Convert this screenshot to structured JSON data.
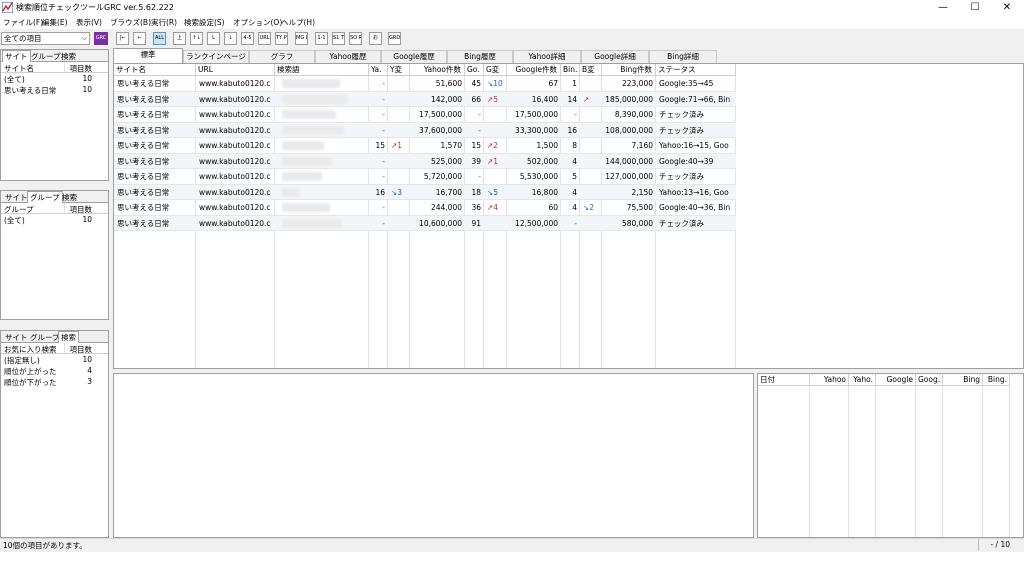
{
  "title": "検索順位チェックツールGRC  ver.5.62.222",
  "window_controls": {
    "minimize": "—",
    "maximize": "☐",
    "close": "✕"
  },
  "menu": [
    "ファイル(F)",
    "編集(E)",
    "表示(V)",
    "ブラウズ(B)",
    "実行(R)",
    "検索設定(S)",
    "オプション(O)",
    "ヘルプ(H)"
  ],
  "toolbar": {
    "filter_value": "全ての項目",
    "grc_label": "GRC",
    "buttons": [
      "|←",
      "←",
      "ALL",
      "上",
      "↑↓",
      "L",
      "↓",
      "4-5",
      "URL",
      "TY PB",
      "MG DB",
      "1-1",
      "S1 TB",
      "SO RO",
      "お",
      "GRD UP"
    ]
  },
  "panels": {
    "site": {
      "tabs": [
        "サイト",
        "グループ",
        "検索"
      ],
      "headers": [
        "サイト名",
        "項目数"
      ],
      "rows": [
        {
          "name": "(全て)",
          "count": "10"
        },
        {
          "name": "思い考える日常",
          "count": "10"
        }
      ]
    },
    "group": {
      "tabs": [
        "サイト",
        "グループ",
        "検索"
      ],
      "headers": [
        "グループ",
        "項目数"
      ],
      "rows": [
        {
          "name": "(全て)",
          "count": "10"
        }
      ]
    },
    "search": {
      "tabs": [
        "サイト",
        "グループ",
        "検索"
      ],
      "headers": [
        "お気に入り検索",
        "項目数"
      ],
      "rows": [
        {
          "name": "(指定無し)",
          "count": "10"
        },
        {
          "name": "順位が上がった",
          "count": "4"
        },
        {
          "name": "順位が下がった",
          "count": "3"
        }
      ]
    }
  },
  "main_tabs": [
    "標準",
    "ランクインページ",
    "グラフ",
    "Yahoo履歴",
    "Google履歴",
    "Bing履歴",
    "Yahoo詳細",
    "Google詳細",
    "Bing詳細"
  ],
  "grid": {
    "headers": [
      "サイト名",
      "URL",
      "検索語",
      "Ya.",
      "Y変",
      "Yahoo件数",
      "Go.",
      "G変",
      "Google件数",
      "Bin.",
      "B変",
      "Bing件数",
      "ステータス"
    ],
    "rows": [
      {
        "site": "思い考える日常",
        "url": "www.kabuto0120.c",
        "ya": "-",
        "yc": "",
        "ycount": "51,600",
        "go": "45",
        "gc": "↘10",
        "gdir": "down",
        "gcount": "67",
        "bi": "1",
        "bc": "",
        "bcount": "223,000",
        "status": "Google:35→45"
      },
      {
        "site": "思い考える日常",
        "url": "www.kabuto0120.c",
        "ya": "-",
        "yc": "",
        "ycount": "142,000",
        "go": "66",
        "gc": "↗5",
        "gdir": "up",
        "gcount": "16,400",
        "bi": "14",
        "bc": "↗",
        "bdir": "up",
        "bcount": "185,000,000",
        "status": "Google:71→66, Bin"
      },
      {
        "site": "思い考える日常",
        "url": "www.kabuto0120.c",
        "ya": "-",
        "yc": "",
        "ycount": "17,500,000",
        "go": "-",
        "gc": "",
        "gcount": "17,500,000",
        "bi": "-",
        "bc": "",
        "bcount": "8,390,000",
        "status": "チェック済み"
      },
      {
        "site": "思い考える日常",
        "url": "www.kabuto0120.c",
        "ya": "-",
        "yc": "",
        "ycount": "37,600,000",
        "go": "-",
        "gc": "",
        "gcount": "33,300,000",
        "bi": "16",
        "bc": "",
        "bcount": "108,000,000",
        "status": "チェック済み"
      },
      {
        "site": "思い考える日常",
        "url": "www.kabuto0120.c",
        "ya": "15",
        "yc": "↗1",
        "ydir": "up",
        "ycount": "1,570",
        "go": "15",
        "gc": "↗2",
        "gdir": "up",
        "gcount": "1,500",
        "bi": "8",
        "bc": "",
        "bcount": "7,160",
        "status": "Yahoo:16→15, Goo"
      },
      {
        "site": "思い考える日常",
        "url": "www.kabuto0120.c",
        "ya": "-",
        "yc": "",
        "ycount": "525,000",
        "go": "39",
        "gc": "↗1",
        "gdir": "up",
        "gcount": "502,000",
        "bi": "4",
        "bc": "",
        "bcount": "144,000,000",
        "status": "Google:40→39"
      },
      {
        "site": "思い考える日常",
        "url": "www.kabuto0120.c",
        "ya": "-",
        "yc": "",
        "ycount": "5,720,000",
        "go": "-",
        "gc": "",
        "gcount": "5,530,000",
        "bi": "5",
        "bc": "",
        "bcount": "127,000,000",
        "status": "チェック済み"
      },
      {
        "site": "思い考える日常",
        "url": "www.kabuto0120.c",
        "ya": "16",
        "yc": "↘3",
        "ydir": "down",
        "ycount": "16,700",
        "go": "18",
        "gc": "↘5",
        "gdir": "down",
        "gcount": "16,800",
        "bi": "4",
        "bc": "",
        "bcount": "2,150",
        "status": "Yahoo:13→16, Goo"
      },
      {
        "site": "思い考える日常",
        "url": "www.kabuto0120.c",
        "ya": "-",
        "yc": "",
        "ycount": "244,000",
        "go": "36",
        "gc": "↗4",
        "gdir": "up",
        "gcount": "60",
        "bi": "4",
        "bc": "↘2",
        "bdir": "down",
        "bcount": "75,500",
        "status": "Google:40→36, Bin"
      },
      {
        "site": "思い考える日常",
        "url": "www.kabuto0120.c",
        "ya": "-",
        "yc": "",
        "ycount": "10,600,000",
        "go": "91",
        "gc": "",
        "gcount": "12,500,000",
        "bi": "-",
        "bc": "",
        "bcount": "580,000",
        "status": "チェック済み"
      }
    ]
  },
  "history": {
    "headers": [
      "日付",
      "Yahoo",
      "Yaho.",
      "Google",
      "Goog.",
      "Bing",
      "Bing."
    ]
  },
  "status": {
    "text": "10個の項目があります。",
    "count": "- / 10"
  }
}
